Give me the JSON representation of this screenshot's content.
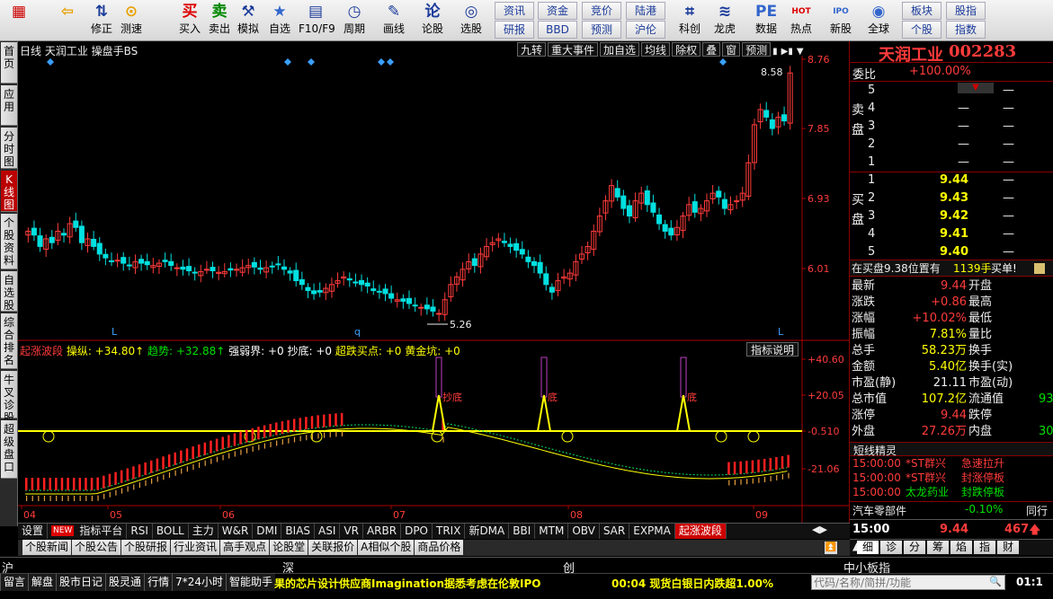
{
  "toolbar": {
    "buttons": [
      {
        "label": "",
        "icon": "windows-logo-icon"
      },
      {
        "label": "",
        "icon": "back-arrow-icon"
      },
      {
        "label": "修正",
        "icon": "up-down-icon"
      },
      {
        "label": "测速",
        "icon": "speed-icon"
      },
      {
        "label": "买入",
        "icon": "buy-icon"
      },
      {
        "label": "卖出",
        "icon": "sell-icon"
      },
      {
        "label": "模拟",
        "icon": "hammer-icon"
      },
      {
        "label": "自选",
        "icon": "star-icon"
      },
      {
        "label": "F10/F9",
        "icon": "f10-icon"
      },
      {
        "label": "周期",
        "icon": "clock-icon"
      },
      {
        "label": "画线",
        "icon": "pencil-icon"
      },
      {
        "label": "论股",
        "icon": "discuss-icon"
      },
      {
        "label": "选股",
        "icon": "select-stock-icon"
      },
      {
        "label": "科创",
        "icon": "kechuang-icon"
      },
      {
        "label": "龙虎",
        "icon": "dragon-icon"
      },
      {
        "label": "数据",
        "icon": "pe-icon"
      },
      {
        "label": "热点",
        "icon": "hot-icon"
      },
      {
        "label": "新股",
        "icon": "ipo-icon"
      },
      {
        "label": "全球",
        "icon": "globe-icon"
      }
    ],
    "small_buttons": [
      "资讯",
      "资金",
      "竞价",
      "陆港",
      "研报",
      "BBD",
      "预测",
      "沪伦",
      "板块",
      "股指",
      "个股",
      "指数"
    ]
  },
  "sidebar": [
    "首页",
    "应用",
    "分时图",
    "K线图",
    "个股资料",
    "自选股",
    "综合排名",
    "牛叉诊股",
    "超级盘口"
  ],
  "chart": {
    "header": "日线  天润工业 操盘手BS",
    "header_buttons": [
      "九转",
      "重大事件",
      "加自选",
      "均线",
      "除权",
      "叠",
      "窗",
      "预测"
    ],
    "price_labels": [
      "8.76",
      "7.85",
      "6.93",
      "6.01"
    ],
    "high_mark": "8.58",
    "low_mark": "5.26",
    "date_labels": [
      "04",
      "05",
      "06",
      "07",
      "08",
      "09"
    ],
    "signal_labels": [
      "L",
      "q",
      "L"
    ],
    "indicator_header": [
      {
        "text": "起涨波段",
        "color": "#ff3b3b"
      },
      {
        "text": "操纵: +34.80↑",
        "color": "#ffff00"
      },
      {
        "text": "趋势: +32.88↑",
        "color": "#00e000"
      },
      {
        "text": "强弱界: +0",
        "color": "#ffffff"
      },
      {
        "text": "抄底: +0",
        "color": "#ffffff"
      },
      {
        "text": "超跌买点: +0",
        "color": "#ffff00"
      },
      {
        "text": "黄金坑: +0",
        "color": "#ffff00"
      }
    ],
    "indicator_button": "指标说明",
    "indicator_labels": [
      "+40.60",
      "+20.05",
      "-0.510",
      "-21.06"
    ],
    "chaodi_label": "抄底",
    "di_label": "底"
  },
  "stock": {
    "name": "天润工业",
    "code": "002283",
    "weibi_label": "委比",
    "weibi_value": "+100.00%",
    "sell_label": "卖盘",
    "buy_label": "买盘",
    "sell_levels": [
      {
        "n": "5",
        "price": "",
        "vol": "—"
      },
      {
        "n": "4",
        "price": "—",
        "vol": "—"
      },
      {
        "n": "3",
        "price": "—",
        "vol": "—"
      },
      {
        "n": "2",
        "price": "—",
        "vol": "—"
      },
      {
        "n": "1",
        "price": "—",
        "vol": "—"
      }
    ],
    "buy_levels": [
      {
        "n": "1",
        "price": "9.44",
        "vol": "—"
      },
      {
        "n": "2",
        "price": "9.43",
        "vol": "—"
      },
      {
        "n": "3",
        "price": "9.42",
        "vol": "—"
      },
      {
        "n": "4",
        "price": "9.41",
        "vol": "—"
      },
      {
        "n": "5",
        "price": "9.40",
        "vol": "—"
      }
    ],
    "order_info": "在买盘9.38位置有",
    "order_vol": "1139手",
    "order_tag": "买单!",
    "stats": [
      {
        "l": "最新",
        "v": "9.44",
        "l2": "开盘",
        "v2": ""
      },
      {
        "l": "涨跌",
        "v": "+0.86",
        "l2": "最高",
        "v2": ""
      },
      {
        "l": "涨幅",
        "v": "+10.02%",
        "l2": "最低",
        "v2": ""
      },
      {
        "l": "振幅",
        "v": "7.81%",
        "l2": "量比",
        "v2": ""
      },
      {
        "l": "总手",
        "v": "58.23万",
        "l2": "换手",
        "v2": ""
      },
      {
        "l": "金额",
        "v": "5.40亿",
        "l2": "换手(实)",
        "v2": ""
      },
      {
        "l": "市盈(静)",
        "v": "21.11",
        "l2": "市盈(动)",
        "v2": ""
      },
      {
        "l": "总市值",
        "v": "107.2亿",
        "l2": "流通值",
        "v2": "93"
      },
      {
        "l": "涨停",
        "v": "9.44",
        "l2": "跌停",
        "v2": ""
      },
      {
        "l": "外盘",
        "v": "27.26万",
        "l2": "内盘",
        "v2": "30"
      }
    ],
    "news_title": "短线精灵",
    "news": [
      {
        "time": "15:00:00",
        "name": "*ST群兴",
        "event": "急速拉升"
      },
      {
        "time": "15:00:00",
        "name": "*ST群兴",
        "event": "封涨停板"
      },
      {
        "time": "15:00:00",
        "name": "太龙药业",
        "event": "封跌停板"
      }
    ],
    "sector_name": "汽车零部件",
    "sector_change": "-0.10%",
    "sector_btn": "同行",
    "tick_time": "15:00",
    "tick_price": "9.44",
    "tick_vol": "467",
    "detail_tabs": [
      "细",
      "诊",
      "分",
      "筹",
      "焰",
      "指",
      "财"
    ]
  },
  "bottom_tabs": [
    "设置",
    "NEW",
    "指标平台",
    "RSI",
    "BOLL",
    "主力",
    "W&R",
    "DMI",
    "BIAS",
    "ASI",
    "VR",
    "ARBR",
    "DPO",
    "TRIX",
    "新DMA",
    "BBI",
    "MTM",
    "OBV",
    "SAR",
    "EXPMA",
    "起涨波段"
  ],
  "sub_tabs": [
    "个股新闻",
    "个股公告",
    "个股研报",
    "行业资讯",
    "高手观点",
    "论股堂",
    "关联报价",
    "A相似个股",
    "商品价格"
  ],
  "status1": [
    "沪",
    "深",
    "创",
    "中小板指"
  ],
  "status2": {
    "items": [
      "留言",
      "解盘",
      "股市日记",
      "股灵通",
      "行情",
      "7*24小时",
      "智能助手"
    ],
    "ticker1": "果的芯片设计供应商Imagination据悉考虑在伦敦IPO",
    "ticker2": "00:04 现货白银日内跌超1.00%",
    "search_placeholder": "代码/名称/简拼/功能",
    "clock": "01:1"
  }
}
